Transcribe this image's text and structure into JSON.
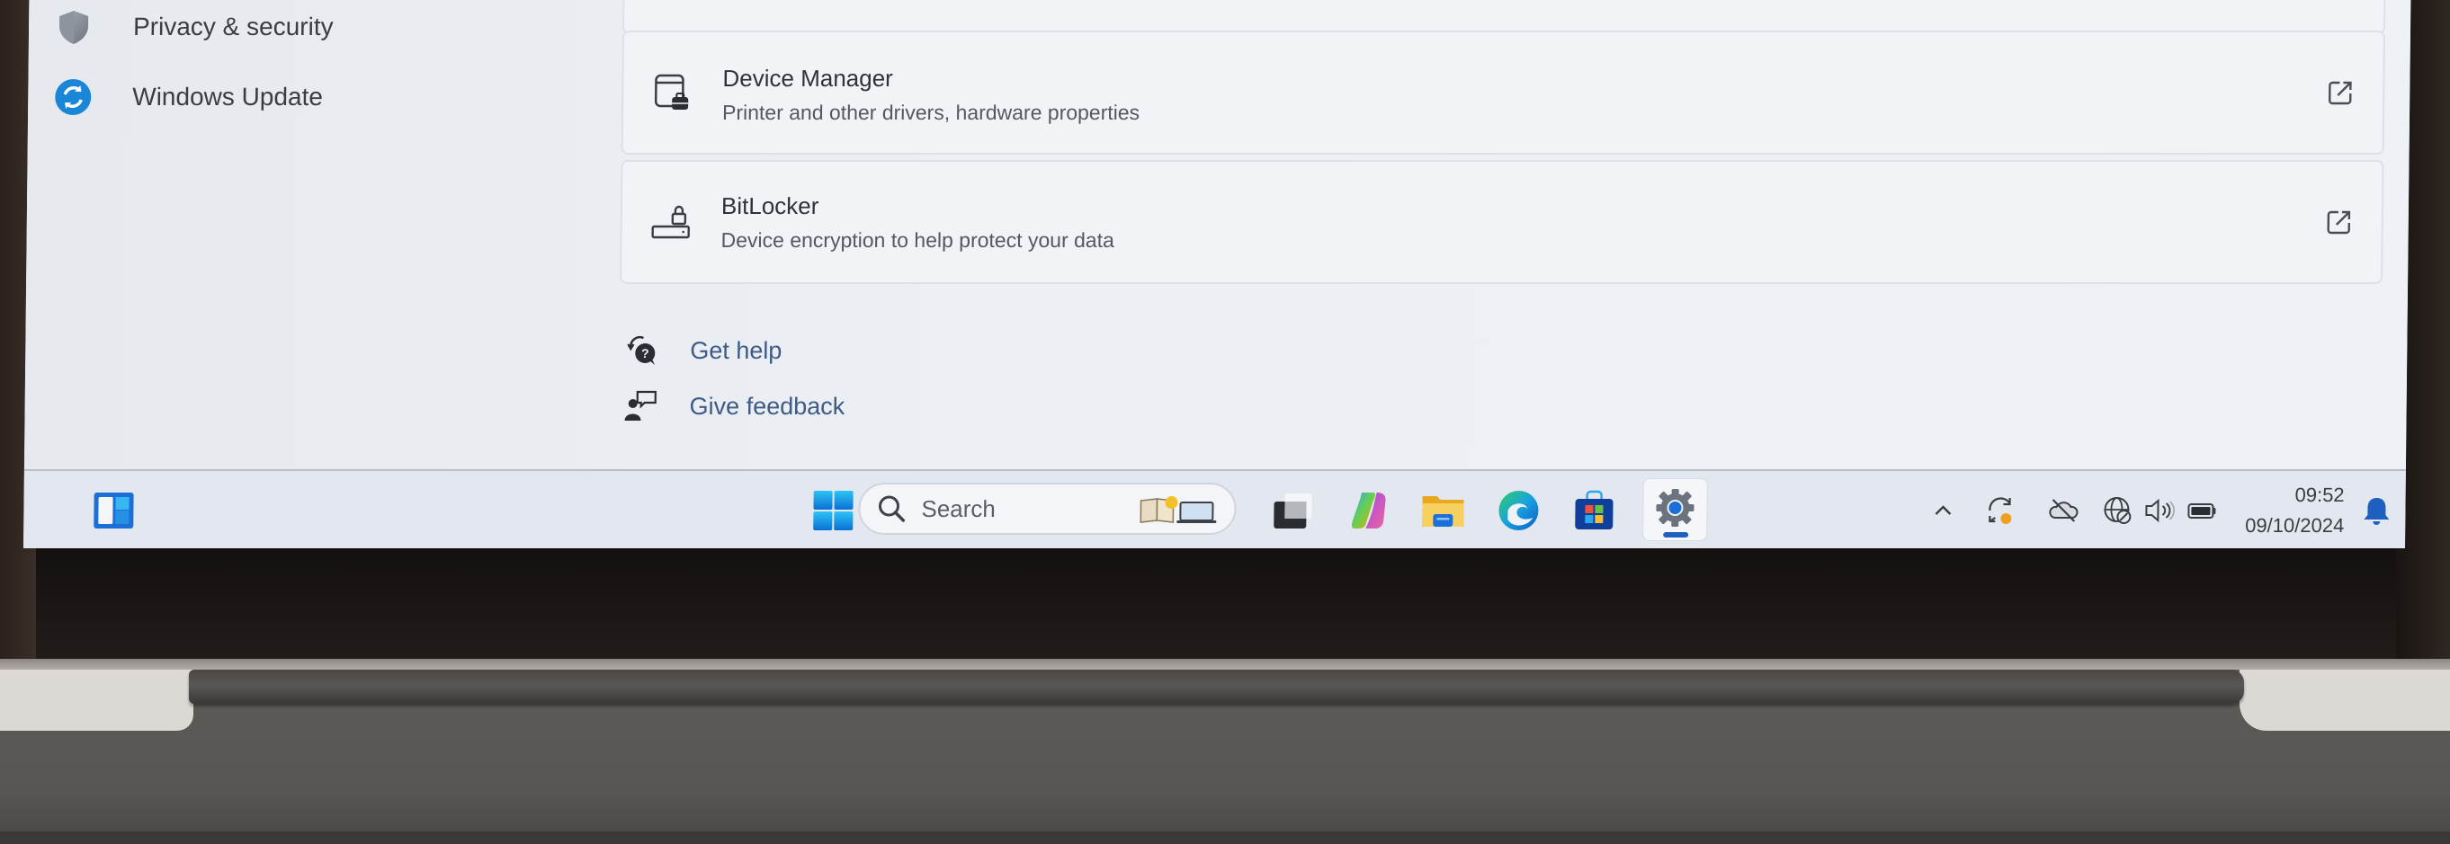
{
  "sidebar": {
    "items": [
      {
        "label": "Privacy & security",
        "icon": "shield-icon"
      },
      {
        "label": "Windows Update",
        "icon": "windows-update-icon"
      }
    ]
  },
  "main": {
    "cards": [
      {
        "title": "Device Manager",
        "subtitle": "Printer and other drivers, hardware properties",
        "icon": "device-manager-icon",
        "action_icon": "external-link-icon"
      },
      {
        "title": "BitLocker",
        "subtitle": "Device encryption to help protect your data",
        "icon": "bitlocker-icon",
        "action_icon": "external-link-icon"
      }
    ],
    "links": [
      {
        "label": "Get help",
        "icon": "get-help-icon"
      },
      {
        "label": "Give feedback",
        "icon": "give-feedback-icon"
      }
    ]
  },
  "taskbar": {
    "widgets_icon": "widgets-icon",
    "start_icon": "windows-start-icon",
    "search": {
      "placeholder": "Search"
    },
    "pinned": [
      {
        "name": "Task View",
        "icon": "task-view-icon"
      },
      {
        "name": "Copilot",
        "icon": "copilot-icon"
      },
      {
        "name": "File Explorer",
        "icon": "file-explorer-icon"
      },
      {
        "name": "Microsoft Edge",
        "icon": "edge-icon"
      },
      {
        "name": "Microsoft Store",
        "icon": "store-icon"
      },
      {
        "name": "Settings",
        "icon": "settings-gear-icon",
        "active": true
      }
    ],
    "tray": {
      "icons": [
        "chevron-up-icon",
        "sync-icon",
        "cloud-off-icon",
        "network-icon",
        "volume-icon",
        "battery-icon"
      ],
      "time": "09:52",
      "date": "09/10/2024",
      "notification_icon": "bell-icon"
    }
  },
  "colors": {
    "accent": "#1f5fbf",
    "link": "#3e5a85",
    "sync_badge": "#f0a020"
  }
}
